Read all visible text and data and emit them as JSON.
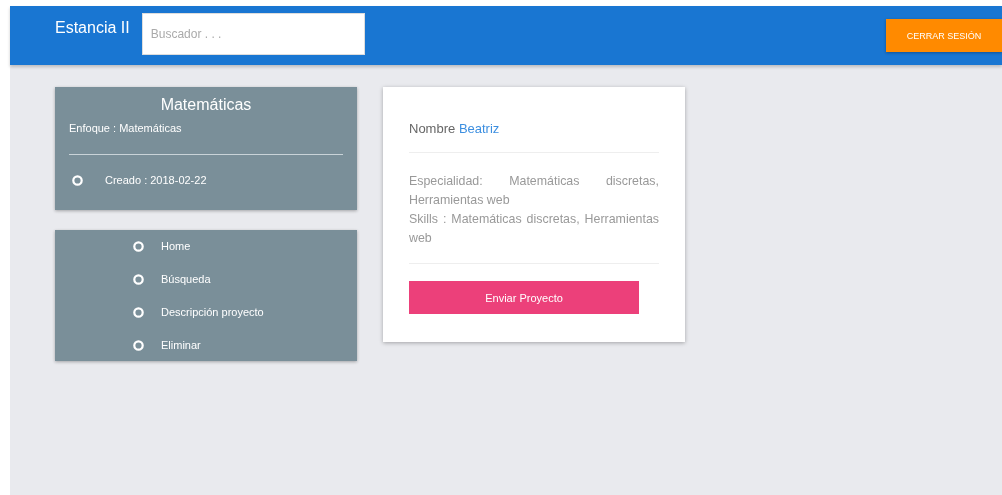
{
  "header": {
    "brand": "Estancia II",
    "search": {
      "placeholder": "Buscador . . ."
    },
    "logout_button": "CERRAR SESIÓN"
  },
  "course_card": {
    "title": "Matemáticas",
    "focus": "Enfoque : Matemáticas",
    "created": "Creado : 2018-02-22"
  },
  "menu": [
    {
      "label": "Home"
    },
    {
      "label": "Búsqueda"
    },
    {
      "label": "Descripción proyecto"
    },
    {
      "label": "Eliminar"
    }
  ],
  "profile_card": {
    "name_label": "Nombre",
    "name": "Beatriz",
    "specialty": "Especialidad: Matemáticas discretas, Herramientas web",
    "skills": "Skills : Matemáticas discretas, Herramientas web",
    "send_button": "Enviar Proyecto"
  }
}
